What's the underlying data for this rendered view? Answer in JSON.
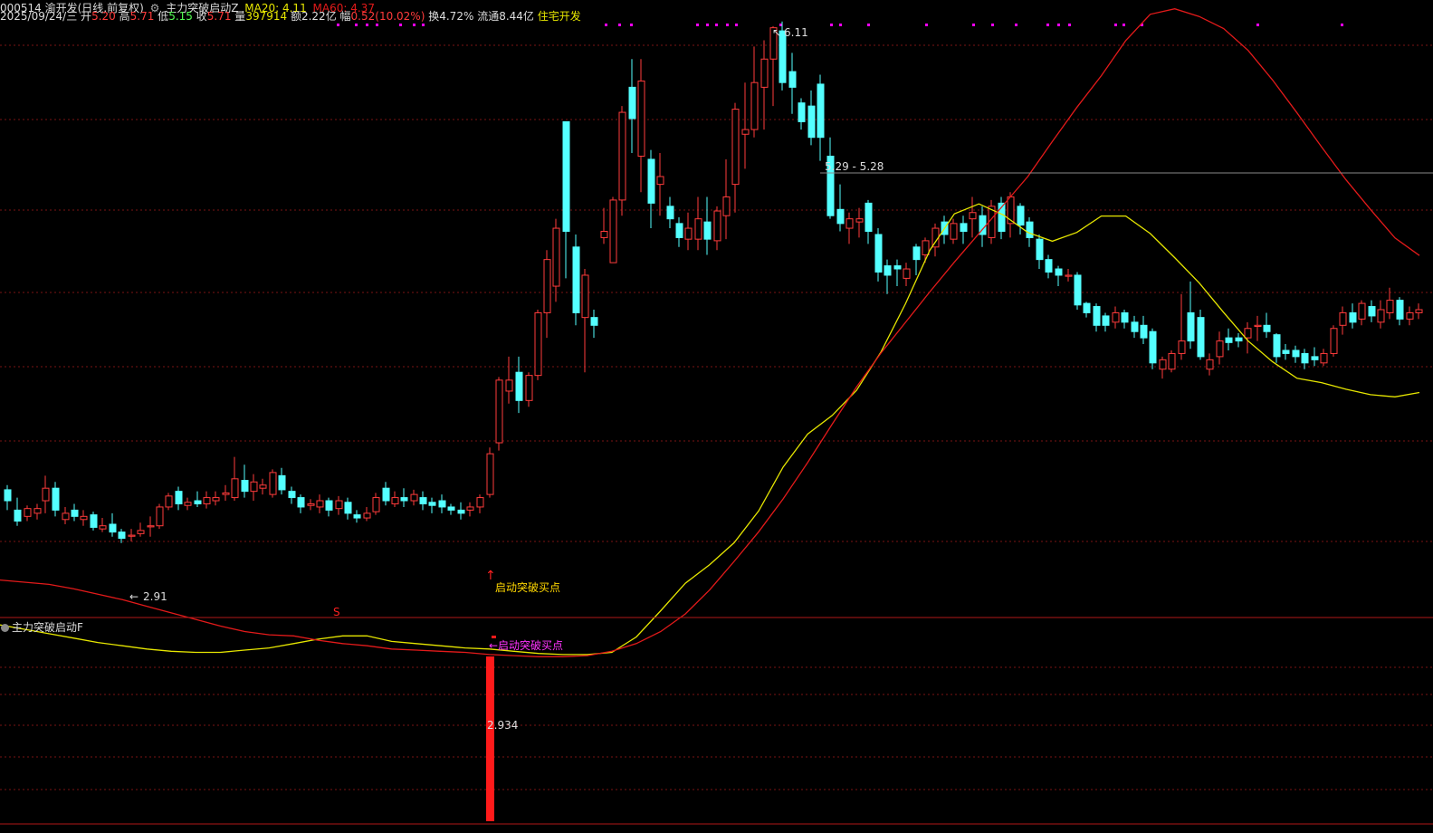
{
  "header": {
    "code_name": "000514 渝开发(日线,前复权)",
    "indicator": "主力突破启动Z",
    "ma20_label": "MA20: 4.11",
    "ma60_label": "MA60: 4.37",
    "date": "2025/09/24/三",
    "open_label": "开",
    "open": "5.20",
    "high_label": "高",
    "high": "5.71",
    "low_label": "低",
    "low": "5.15",
    "close_label": "收",
    "close": "5.71",
    "volume_label": "量",
    "volume": "397914",
    "amount_label": "额",
    "amount": "2.22亿",
    "change_label": "幅",
    "change": "0.52(10.02%)",
    "turnover_label": "换",
    "turnover": "4.72%",
    "float_label": "流通",
    "float_cap": "8.44亿",
    "sector": "住宅开发"
  },
  "sub_panel": {
    "title": "主力突破启动F"
  },
  "colors": {
    "up": "#ff3b3b",
    "down": "#54ffff",
    "ma20": "#e6e600",
    "ma60": "#e31a1a",
    "grid": "#7a1414",
    "signal_text": "#ffd700",
    "signal_text_sub": "#ff33ff",
    "marker": "#ff00ff"
  },
  "chart_data": {
    "type": "candlestick",
    "price_high_label": "6.11",
    "price_low_label": "2.91",
    "crosshair_label": "5.29 - 5.28",
    "signal_label": "启动突破买点",
    "signal_label_sub": "←启动突破买点",
    "signal_value": "2.934",
    "marker_s": "S",
    "series": [
      {
        "name": "MA20",
        "values": [
          3.41,
          3.37,
          3.33,
          3.29,
          3.25,
          3.22,
          3.19,
          3.17,
          3.16,
          3.16,
          3.18,
          3.2,
          3.24,
          3.28,
          3.31,
          3.31,
          3.26,
          3.24,
          3.22,
          3.2,
          3.19,
          3.17,
          3.15,
          3.14,
          3.14,
          3.16,
          3.3,
          3.54,
          3.79,
          3.96,
          4.16,
          4.45,
          4.85,
          5.15,
          5.32,
          5.55,
          5.9,
          6.34,
          6.83,
          7.16,
          7.25,
          7.15,
          6.99,
          6.91,
          6.99,
          7.14,
          7.14,
          6.98,
          6.76,
          6.53,
          6.26,
          6.0,
          5.81,
          5.66,
          5.62,
          5.56,
          5.51,
          5.49,
          5.53
        ]
      },
      {
        "name": "MA60",
        "values": [
          3.82,
          3.8,
          3.78,
          3.74,
          3.69,
          3.64,
          3.58,
          3.52,
          3.46,
          3.4,
          3.35,
          3.32,
          3.31,
          3.27,
          3.24,
          3.22,
          3.19,
          3.18,
          3.17,
          3.16,
          3.14,
          3.13,
          3.12,
          3.12,
          3.13,
          3.17,
          3.24,
          3.35,
          3.51,
          3.73,
          3.99,
          4.26,
          4.56,
          4.89,
          5.24,
          5.58,
          5.89,
          6.17,
          6.45,
          6.72,
          6.98,
          7.24,
          7.5,
          7.82,
          8.13,
          8.42,
          8.74,
          8.98,
          9.03,
          8.96,
          8.85,
          8.65,
          8.38,
          8.08,
          7.77,
          7.47,
          7.2,
          6.94,
          6.78
        ]
      }
    ]
  }
}
